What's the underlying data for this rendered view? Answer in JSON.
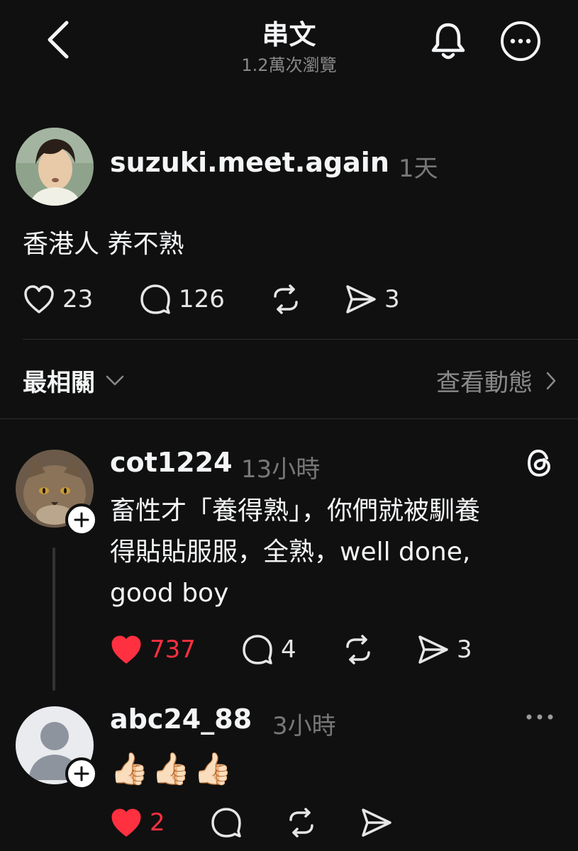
{
  "header": {
    "title": "串文",
    "views": "1.2萬次瀏覽"
  },
  "post": {
    "username": "suzuki.meet.again",
    "time": "1天",
    "text": "香港人 养不熟",
    "likes": "23",
    "replies": "126",
    "shares": "3"
  },
  "sort": {
    "label": "最相關",
    "activity_label": "查看動態"
  },
  "comments": [
    {
      "username": "cot1224",
      "time": "13小時",
      "text_lines": [
        "畜性才「養得熟」，你們就被馴養",
        "得貼貼服服，全熟，well done,",
        "good boy"
      ],
      "likes": "737",
      "replies": "4",
      "shares": "3",
      "liked": true
    },
    {
      "username": "abc24_88",
      "time": "3小時",
      "emoji": [
        "👍🏻",
        "👍🏻",
        "👍🏻"
      ],
      "likes": "2",
      "liked": true
    }
  ],
  "colors": {
    "background": "#101010",
    "like_red": "#ff3040",
    "secondary_text": "#777777"
  },
  "icons": {
    "back": "chevron-left-icon",
    "bell": "bell-icon",
    "more": "more-icon",
    "heart": "heart-icon",
    "reply": "comment-bubble-icon",
    "repost": "repost-icon",
    "share": "send-icon",
    "threads": "threads-logo-icon"
  }
}
